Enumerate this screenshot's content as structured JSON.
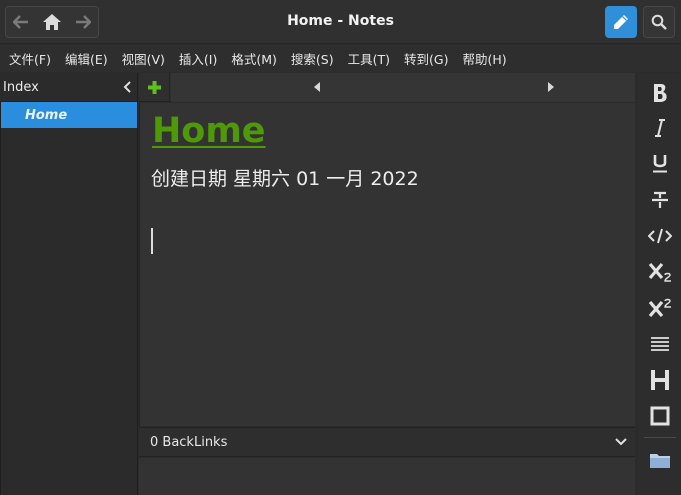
{
  "window": {
    "title": "Home - Notes"
  },
  "toolbar": {
    "back_icon": "arrow-left-icon",
    "home_icon": "home-icon",
    "forward_icon": "arrow-right-icon",
    "edit_icon": "pencil-icon",
    "search_icon": "search-icon",
    "edit_active_color": "#2f8fd8"
  },
  "menu": [
    "文件(F)",
    "编辑(E)",
    "视图(V)",
    "插入(I)",
    "格式(M)",
    "搜索(S)",
    "工具(T)",
    "转到(G)",
    "帮助(H)"
  ],
  "sidebar": {
    "header": "Index",
    "items": [
      {
        "label": "Home",
        "selected": true
      }
    ]
  },
  "page": {
    "title": "Home",
    "created": "创建日期 星期六 01 一月 2022",
    "title_color": "#4e9a06"
  },
  "backlinks": {
    "label": "0 BackLinks"
  },
  "format_toolbar": [
    "bold-icon",
    "italic-icon",
    "underline-icon",
    "strikethrough-icon",
    "code-icon",
    "subscript-icon",
    "superscript-icon",
    "bullet-list-icon",
    "heading-icon",
    "checkbox-icon",
    "folder-icon"
  ]
}
